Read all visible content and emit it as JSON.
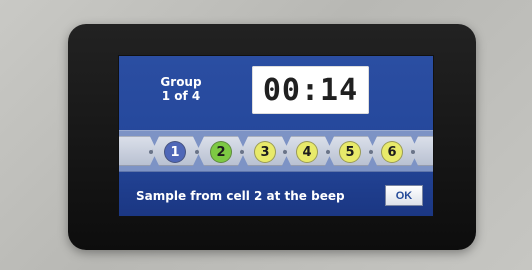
{
  "device": {
    "group_line_1": "Group",
    "group_line_2": "1 of 4",
    "timer": "00:14",
    "message": "Sample from cell 2 at the beep",
    "ok_label": "OK"
  },
  "cells": {
    "labels": [
      "1",
      "2",
      "3",
      "4",
      "5",
      "6"
    ],
    "colors": {
      "active": "#4f67b8",
      "target": "#7dca43",
      "pending": "#e8ea6a"
    }
  }
}
